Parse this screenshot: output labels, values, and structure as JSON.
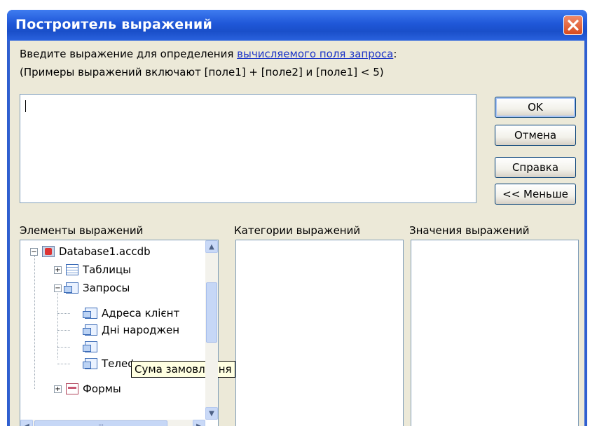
{
  "window": {
    "title": "Построитель выражений"
  },
  "instructions": {
    "line1_prefix": "Введите выражение для определения ",
    "line1_link": "вычисляемого поля запроса",
    "line1_suffix": ":",
    "line2": "(Примеры выражений включают [поле1] + [поле2] и [поле1] < 5)"
  },
  "expression": {
    "value": ""
  },
  "buttons": {
    "ok": "OK",
    "cancel": "Отмена",
    "help": "Справка",
    "less": "<< Меньше"
  },
  "sections": {
    "elements": "Элементы выражений",
    "categories": "Категории выражений",
    "values": "Значения выражений"
  },
  "tree": {
    "root": {
      "label": "Database1.accdb",
      "icon": "database-icon",
      "expander": "−"
    },
    "tables": {
      "label": "Таблицы",
      "icon": "table-icon",
      "expander": "+"
    },
    "queries": {
      "label": "Запросы",
      "icon": "query-icon",
      "expander": "−"
    },
    "query_items": [
      {
        "label": "Адреса клієнт",
        "icon": "query-icon"
      },
      {
        "label": "Дні народжен",
        "icon": "query-icon"
      },
      {
        "label": "",
        "icon": "query-icon"
      },
      {
        "label": "Телефони",
        "icon": "query-icon"
      }
    ],
    "forms": {
      "label": "Формы",
      "icon": "form-icon",
      "expander": "+"
    },
    "tooltip": "Сума замовлення"
  },
  "scrollbars": {
    "thumb_grip": "|||"
  },
  "icons": {
    "close": "close-icon",
    "up": "▲",
    "down": "▼",
    "left": "◀",
    "right": "▶"
  },
  "colors": {
    "title_bar": "#1f57d8",
    "dialog_bg": "#ece9d8",
    "link": "#1c35c7",
    "close": "#d84a1c"
  }
}
